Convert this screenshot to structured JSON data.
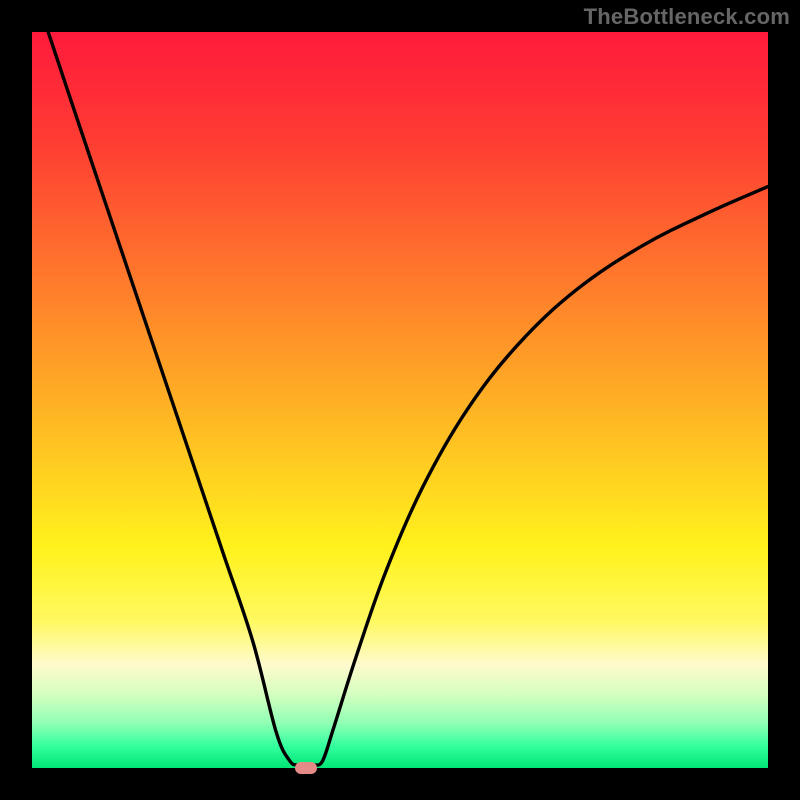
{
  "attribution": "TheBottleneck.com",
  "colors": {
    "frame": "#000000",
    "curve": "#000000",
    "gradient_stops": [
      {
        "offset": 0.0,
        "color": "#ff1a3c"
      },
      {
        "offset": 0.14,
        "color": "#ff3a33"
      },
      {
        "offset": 0.28,
        "color": "#ff672e"
      },
      {
        "offset": 0.42,
        "color": "#ff9528"
      },
      {
        "offset": 0.56,
        "color": "#ffc322"
      },
      {
        "offset": 0.7,
        "color": "#fff21c"
      },
      {
        "offset": 0.8,
        "color": "#fff960"
      },
      {
        "offset": 0.86,
        "color": "#fffacd"
      },
      {
        "offset": 0.9,
        "color": "#d4ffc0"
      },
      {
        "offset": 0.94,
        "color": "#8effb4"
      },
      {
        "offset": 0.97,
        "color": "#33ff9f"
      },
      {
        "offset": 1.0,
        "color": "#00e676"
      }
    ],
    "marker": "#e48a87"
  },
  "chart_data": {
    "type": "line",
    "title": "",
    "xlabel": "",
    "ylabel": "",
    "xlim": [
      0,
      1
    ],
    "ylim": [
      0,
      1
    ],
    "categories": [],
    "series": [
      {
        "name": "left-branch",
        "x": [
          0.022,
          0.06,
          0.1,
          0.14,
          0.18,
          0.22,
          0.26,
          0.3,
          0.332,
          0.35,
          0.36
        ],
        "y": [
          1.0,
          0.886,
          0.767,
          0.648,
          0.529,
          0.41,
          0.291,
          0.172,
          0.048,
          0.01,
          0.004
        ]
      },
      {
        "name": "right-branch",
        "x": [
          0.384,
          0.395,
          0.41,
          0.44,
          0.48,
          0.53,
          0.59,
          0.66,
          0.74,
          0.83,
          0.92,
          1.0
        ],
        "y": [
          0.004,
          0.01,
          0.055,
          0.15,
          0.265,
          0.38,
          0.485,
          0.575,
          0.65,
          0.71,
          0.755,
          0.79
        ]
      }
    ],
    "marker": {
      "x": 0.372,
      "y": 0.0
    }
  }
}
